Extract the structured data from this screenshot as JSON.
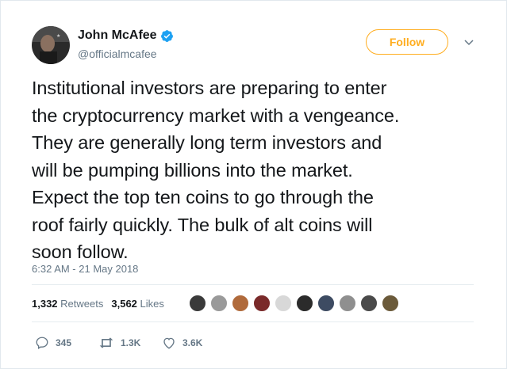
{
  "user": {
    "name": "John McAfee",
    "handle": "@officialmcafee",
    "verified_color": "#1da1f2"
  },
  "follow_label": "Follow",
  "accent_color": "#ffad1f",
  "tweet": {
    "lines": [
      "Institutional investors are preparing to enter",
      "the cryptocurrency market with a vengeance.",
      "They are generally long term investors and",
      "will be pumping billions into the market.",
      "Expect the top ten coins to go through the",
      "roof fairly quickly. The bulk of alt coins will",
      "soon follow."
    ],
    "timestamp": "6:32 AM - 21 May 2018"
  },
  "stats": {
    "retweets_count": "1,332",
    "retweets_label": "Retweets",
    "likes_count": "3,562",
    "likes_label": "Likes"
  },
  "liker_avatars": [
    {
      "color": "#3a3a3a"
    },
    {
      "color": "#9a9a9a"
    },
    {
      "color": "#b06a3b"
    },
    {
      "color": "#7a2a2a"
    },
    {
      "color": "#d8d8d8"
    },
    {
      "color": "#2b2b2b"
    },
    {
      "color": "#3d4b62"
    },
    {
      "color": "#8f8f8f"
    },
    {
      "color": "#4a4a4a"
    },
    {
      "color": "#6b5a3a"
    }
  ],
  "actions": {
    "replies": "345",
    "retweets": "1.3K",
    "likes": "3.6K"
  }
}
